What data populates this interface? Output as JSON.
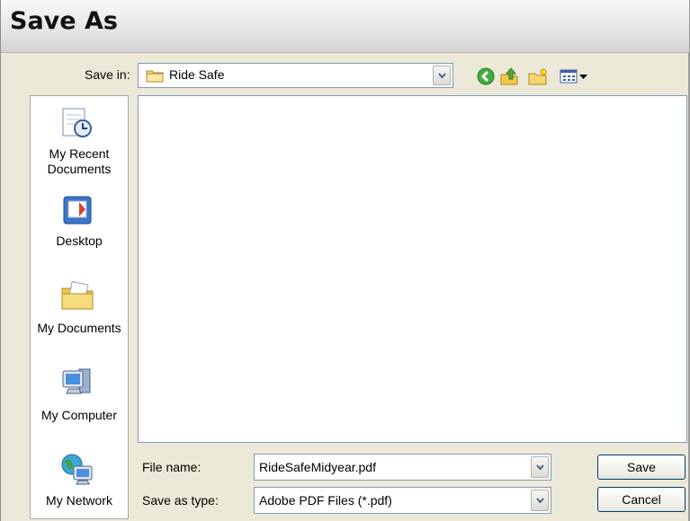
{
  "dialog": {
    "title": "Save As"
  },
  "save_in": {
    "label": "Save in:",
    "value": "Ride Safe",
    "folder_icon": "folder-icon"
  },
  "toolbar": {
    "back_icon": "back-icon",
    "up_icon": "up-folder-icon",
    "new_folder_icon": "new-folder-icon",
    "views_icon": "views-menu-icon"
  },
  "places": [
    {
      "label": "My Recent\nDocuments",
      "icon": "recent-documents-icon"
    },
    {
      "label": "Desktop",
      "icon": "desktop-icon"
    },
    {
      "label": "My Documents",
      "icon": "my-documents-icon"
    },
    {
      "label": "My Computer",
      "icon": "my-computer-icon"
    },
    {
      "label": "My Network",
      "icon": "my-network-icon"
    }
  ],
  "file_name": {
    "label": "File name:",
    "value": "RideSafeMidyear.pdf"
  },
  "save_type": {
    "label": "Save as type:",
    "value": "Adobe PDF Files (*.pdf)"
  },
  "buttons": {
    "save": "Save",
    "cancel": "Cancel"
  }
}
